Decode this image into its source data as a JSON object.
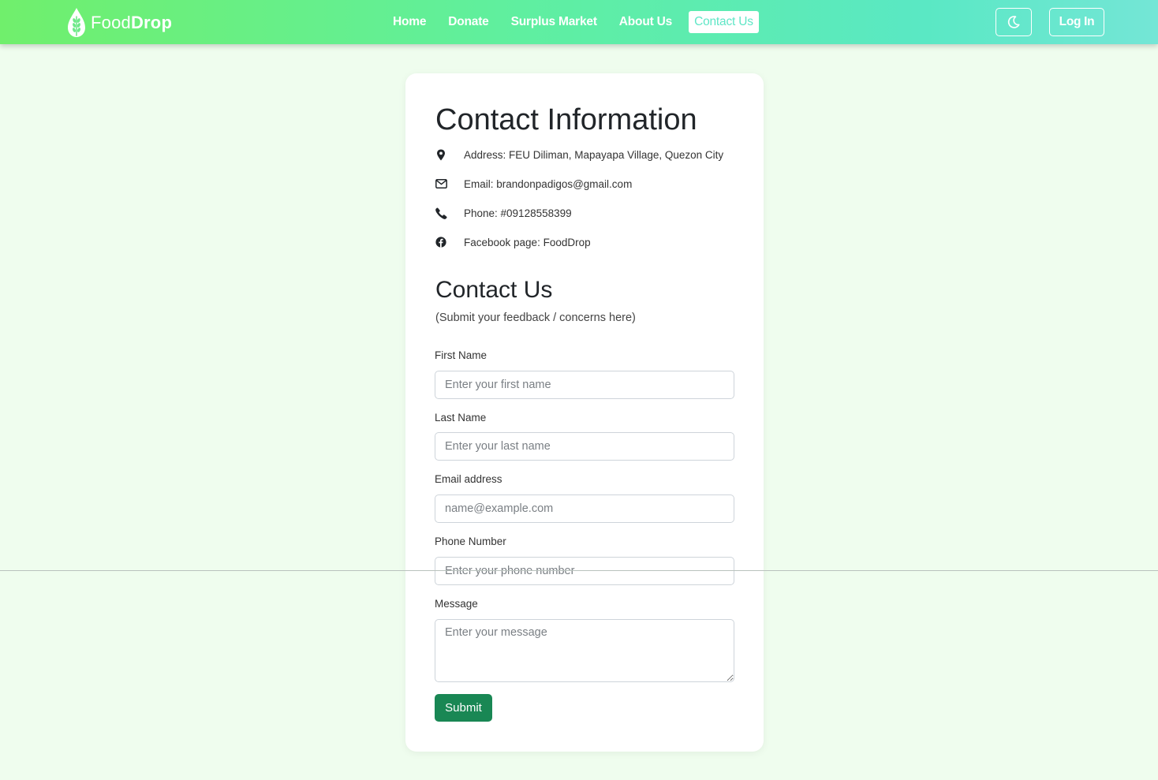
{
  "navbar": {
    "brand_light": "Food",
    "brand_bold": "Drop",
    "links": [
      {
        "label": "Home"
      },
      {
        "label": "Donate"
      },
      {
        "label": "Surplus Market"
      },
      {
        "label": "About Us"
      },
      {
        "label": "Contact Us",
        "active": true
      }
    ],
    "theme_toggle_icon": "moon-icon",
    "login_label": "Log In",
    "colors": {
      "gradient_start": "#70ef6c",
      "gradient_end": "#74e6d6",
      "active_text": "#5fe6c6"
    }
  },
  "contact_info": {
    "title": "Contact Information",
    "items": [
      {
        "icon": "map-pin-icon",
        "text": "Address: FEU Diliman, Mapayapa Village, Quezon City"
      },
      {
        "icon": "envelope-icon",
        "text": "Email: brandonpadigos@gmail.com"
      },
      {
        "icon": "phone-icon",
        "text": "Phone: #09128558399"
      },
      {
        "icon": "facebook-icon",
        "text": "Facebook page: FoodDrop"
      }
    ]
  },
  "contact_form": {
    "title": "Contact Us",
    "subtitle": "(Submit your feedback / concerns here)",
    "fields": {
      "first_name": {
        "label": "First Name",
        "placeholder": "Enter your first name",
        "value": ""
      },
      "last_name": {
        "label": "Last Name",
        "placeholder": "Enter your last name",
        "value": ""
      },
      "email": {
        "label": "Email address",
        "placeholder": "name@example.com",
        "value": ""
      },
      "phone": {
        "label": "Phone Number",
        "placeholder": "Enter your phone number",
        "value": ""
      },
      "message": {
        "label": "Message",
        "placeholder": "Enter your message",
        "value": ""
      }
    },
    "submit_label": "Submit",
    "submit_color": "#198754"
  },
  "page": {
    "background": "#effdee"
  }
}
